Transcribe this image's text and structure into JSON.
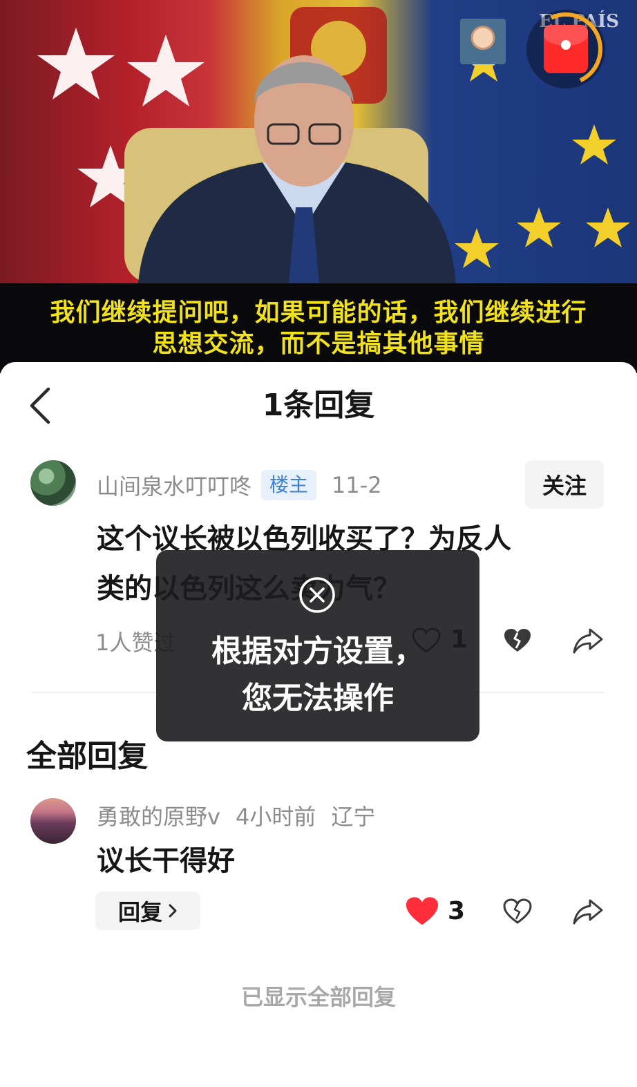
{
  "video": {
    "watermark": "EL PAÍS",
    "subtitle_line1": "我们继续提问吧，如果可能的话，我们继续进行",
    "subtitle_line2": "思想交流，而不是搞其他事情"
  },
  "header": {
    "title": "1条回复"
  },
  "main_comment": {
    "username": "山间泉水叮叮咚",
    "badge": "楼主",
    "date": "11-2",
    "follow_label": "关注",
    "text_line1": "这个议长被以色列收买了？为反人",
    "text_line2": "类的以色列这么卖力气？",
    "liked_by": "1人赞过",
    "like_count": "1"
  },
  "toast": {
    "line1": "根据对方设置，",
    "line2": "您无法操作"
  },
  "replies_section": {
    "title": "全部回复",
    "items": [
      {
        "username": "勇敢的原野v",
        "time": "4小时前",
        "location": "辽宁",
        "text": "议长干得好",
        "reply_label": "回复",
        "like_count": "3"
      }
    ],
    "footer": "已显示全部回复"
  },
  "colors": {
    "subtitle": "#f2e21c",
    "badge_text": "#3b7fd6",
    "badge_bg": "#e8f1fb",
    "like_red": "#ff2d3a",
    "muted": "#8c8c8c"
  }
}
